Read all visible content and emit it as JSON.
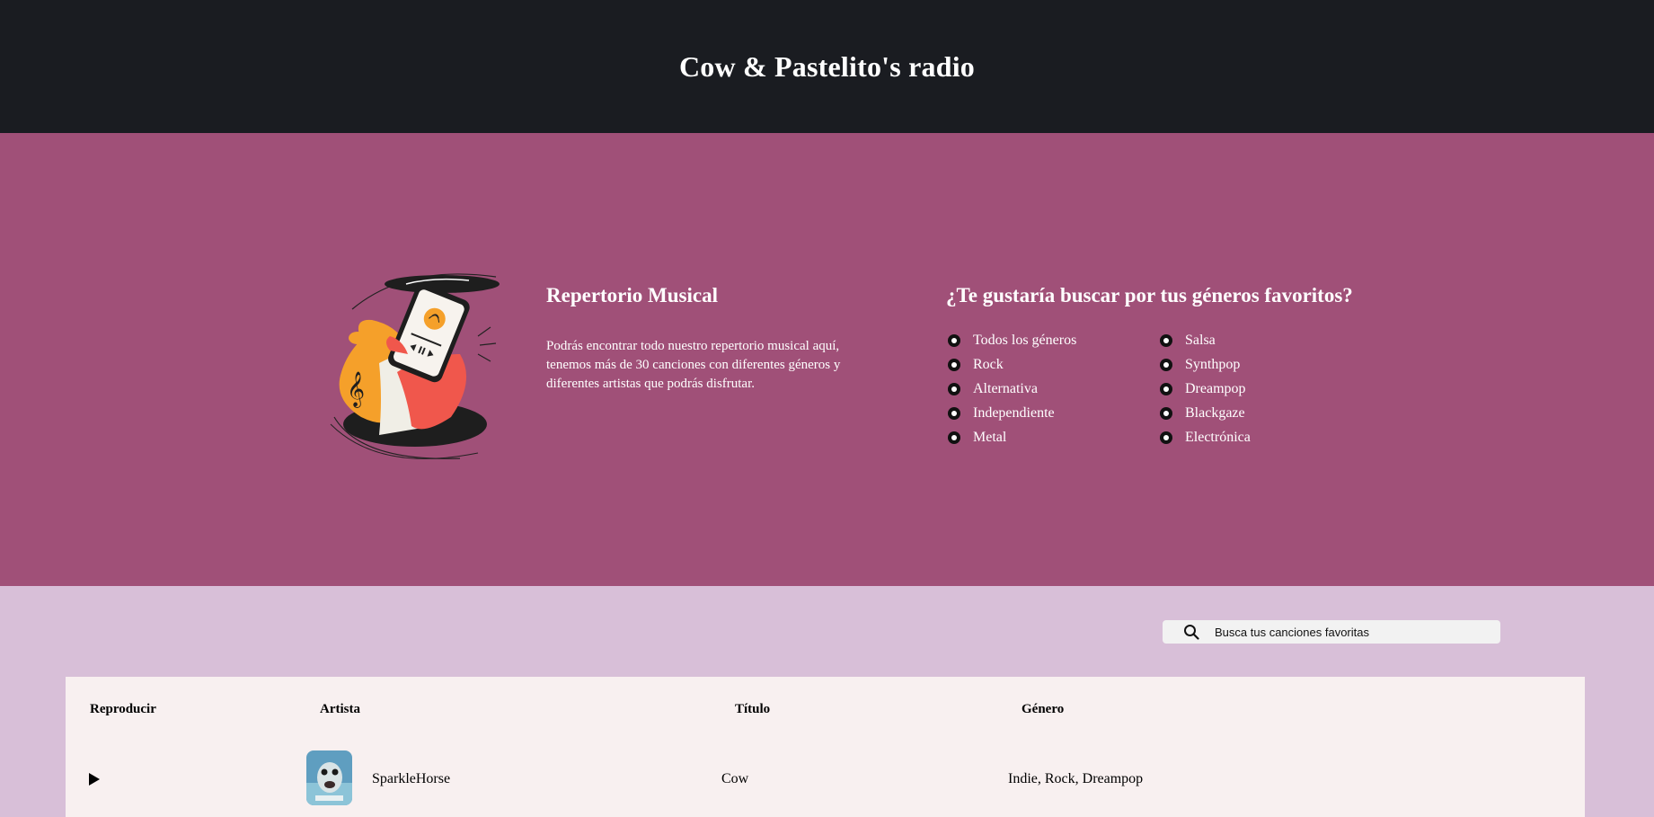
{
  "header": {
    "title": "Cow & Pastelito's radio"
  },
  "hero": {
    "repertorio": {
      "heading": "Repertorio Musical",
      "lines": [
        "Podrás encontrar todo nuestro repertorio musical aquí,",
        "tenemos más de 30 canciones con diferentes géneros y",
        "diferentes artistas que podrás disfrutar."
      ]
    },
    "genres": {
      "heading": "¿Te gustaría buscar por tus géneros favoritos?",
      "left": [
        "Todos los géneros",
        "Rock",
        "Alternativa",
        "Independiente",
        "Metal"
      ],
      "right": [
        "Salsa",
        "Synthpop",
        "Dreampop",
        "Blackgaze",
        "Electrónica"
      ]
    }
  },
  "search": {
    "placeholder": "Busca tus canciones favoritas",
    "icon": "search-icon"
  },
  "table": {
    "headers": {
      "play": "Reproducir",
      "artist": "Artista",
      "title": "Título",
      "genre": "Género"
    },
    "rows": [
      {
        "artist": "SparkleHorse",
        "title": "Cow",
        "genre": "Indie, Rock, Dreampop"
      }
    ]
  },
  "colors": {
    "header_bg": "#1a1c21",
    "hero_bg": "#a05078",
    "lower_bg": "#d8bfd8",
    "table_bg": "#f8f0f0"
  }
}
